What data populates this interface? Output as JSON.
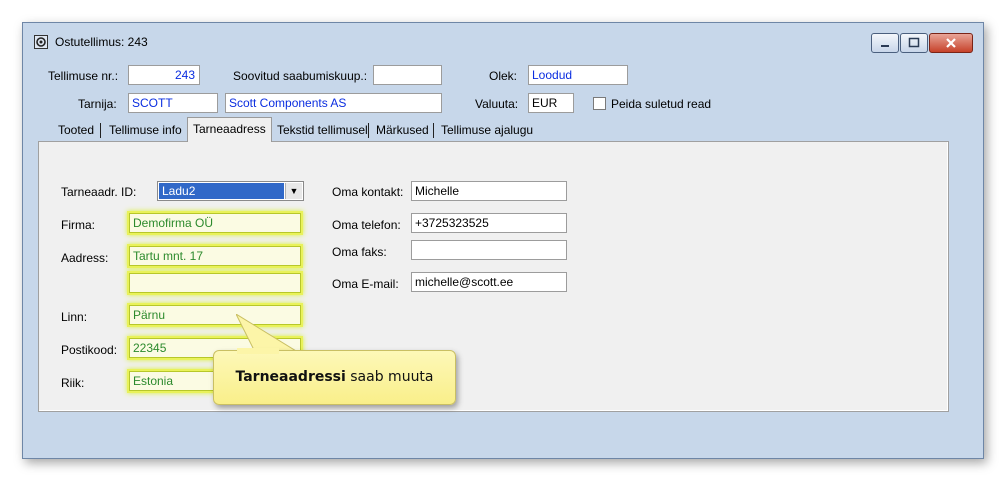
{
  "window": {
    "title": "Ostutellimus: 243"
  },
  "header": {
    "order_no_label": "Tellimuse nr.:",
    "order_no_value": "243",
    "arrival_label": "Soovitud saabumiskuup.:",
    "arrival_value": "",
    "status_label": "Olek:",
    "status_value": "Loodud",
    "supplier_label": "Tarnija:",
    "supplier_code": "SCOTT",
    "supplier_name": "Scott Components AS",
    "currency_label": "Valuuta:",
    "currency_value": "EUR",
    "hide_closed_label": "Peida suletud read",
    "hide_closed_checked": false
  },
  "tabs": [
    {
      "label": "Tooted"
    },
    {
      "label": "Tellimuse info"
    },
    {
      "label": "Tarneaadress",
      "active": true
    },
    {
      "label": "Tekstid tellimusel"
    },
    {
      "label": "Märkused"
    },
    {
      "label": "Tellimuse ajalugu"
    }
  ],
  "delivery": {
    "id_label": "Tarneaadr. ID:",
    "id_value": "Ladu2",
    "company_label": "Firma:",
    "company_value": "Demofirma OÜ",
    "address_label": "Aadress:",
    "address_line1": "Tartu mnt. 17",
    "address_line2": "",
    "address_line3": "",
    "city_label": "Linn:",
    "city_value": "Pärnu",
    "postcode_label": "Postikood:",
    "postcode_value": "22345",
    "country_label": "Riik:",
    "country_value": "Estonia"
  },
  "contact": {
    "contact_label": "Oma kontakt:",
    "contact_value": "Michelle",
    "phone_label": "Oma telefon:",
    "phone_value": "+3725323525",
    "fax_label": "Oma faks:",
    "fax_value": "",
    "email_label": "Oma E-mail:",
    "email_value": "michelle@scott.ee"
  },
  "callout": {
    "bold": "Tarneaadressi",
    "rest": " saab muuta"
  },
  "colors": {
    "value_blue": "#0a2de0",
    "editable_green": "#2c8a2c",
    "highlight_yellow": "#e9f25a",
    "callout_bg": "#fdf8b8"
  }
}
